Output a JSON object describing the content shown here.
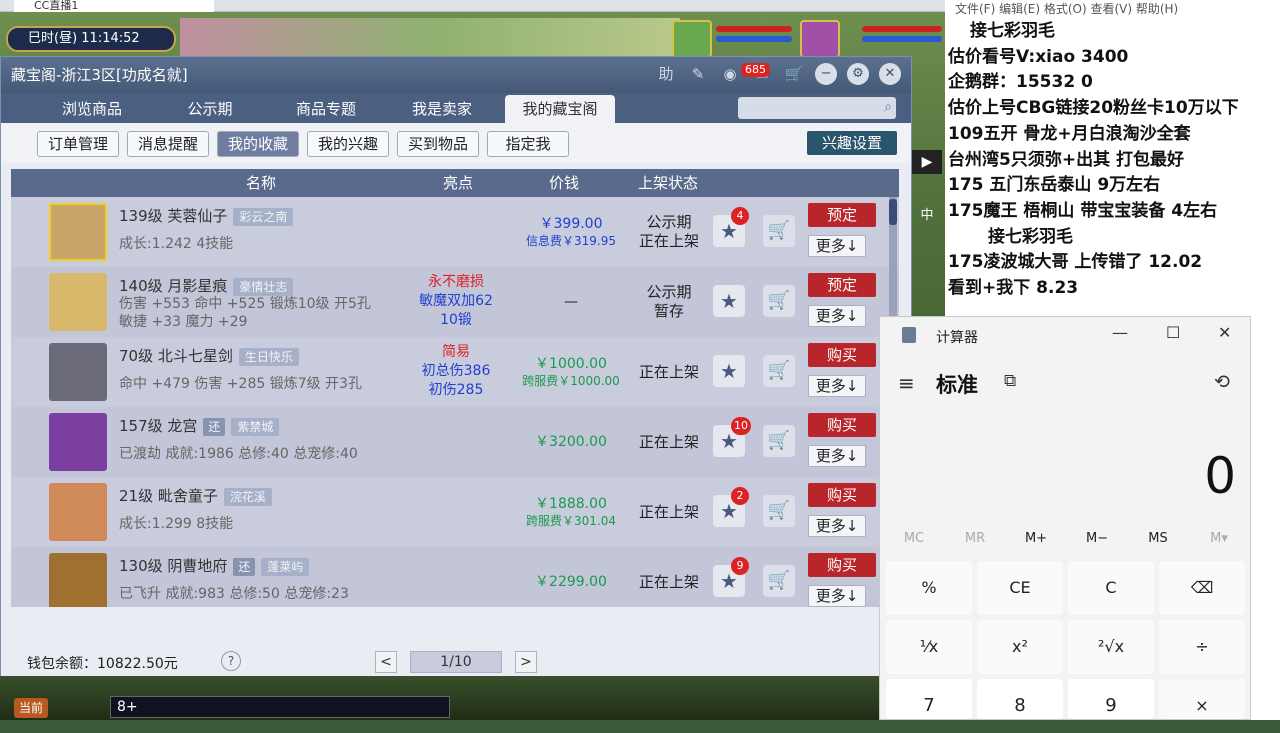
{
  "browser": {
    "tab_title": "CC直播1"
  },
  "game": {
    "time_text": "巳时(昼)  11:14:52"
  },
  "window": {
    "title": "藏宝阁-浙江3区[功成名就]",
    "notif_count": "685",
    "nav_tabs": [
      "浏览商品",
      "公示期",
      "商品专题",
      "我是卖家",
      "我的藏宝阁"
    ],
    "sub_tabs": [
      "订单管理",
      "消息提醒",
      "我的收藏",
      "我的兴趣",
      "买到物品",
      "指定我"
    ],
    "interest_settings": "兴趣设置",
    "columns": {
      "name": "名称",
      "highlight": "亮点",
      "price": "价钱",
      "status": "上架状态"
    },
    "items": [
      {
        "name": "139级  芙蓉仙子",
        "tag": "彩云之南",
        "tag2": "",
        "attrs": "成长:1.242  4技能",
        "hl": [
          "",
          "",
          ""
        ],
        "price": "￥399.00",
        "price_sub": "信息费￥319.95",
        "status": [
          "公示期",
          "正在上架"
        ],
        "badge": "4",
        "action": "预定",
        "more": "更多↓"
      },
      {
        "name": "140级  月影星痕",
        "tag": "豪情壮志",
        "tag2": "",
        "attrs": "伤害 +553  命中 +525  锻炼10级  开5孔",
        "attrs2": "敏捷 +33  魔力 +29",
        "hl": [
          "永不磨损",
          "敏魔双加62",
          "10锻"
        ],
        "price": "—",
        "price_sub": "",
        "status": [
          "公示期",
          "暂存"
        ],
        "badge": "",
        "action": "预定",
        "more": "更多↓"
      },
      {
        "name": "70级  北斗七星剑",
        "tag": "生日快乐",
        "tag2": "",
        "attrs": "命中 +479  伤害 +285  锻炼7级  开3孔",
        "hl": [
          "简易",
          "初总伤386",
          "初伤285"
        ],
        "price": "￥1000.00",
        "price_sub": "跨服费￥1000.00",
        "status": [
          "正在上架",
          ""
        ],
        "badge": "",
        "action": "购买",
        "more": "更多↓"
      },
      {
        "name": "157级  龙宫",
        "tag": "紫禁城",
        "tag2": "还",
        "attrs": "已渡劫  成就:1986  总修:40  总宠修:40",
        "hl": [
          "",
          "",
          ""
        ],
        "price": "￥3200.00",
        "price_sub": "",
        "status": [
          "正在上架",
          ""
        ],
        "badge": "10",
        "action": "购买",
        "more": "更多↓"
      },
      {
        "name": "21级  毗舍童子",
        "tag": "浣花溪",
        "tag2": "",
        "attrs": "成长:1.299  8技能",
        "hl": [
          "",
          "",
          ""
        ],
        "price": "￥1888.00",
        "price_sub": "跨服费￥301.04",
        "status": [
          "正在上架",
          ""
        ],
        "badge": "2",
        "action": "购买",
        "more": "更多↓"
      },
      {
        "name": "130级  阴曹地府",
        "tag": "蓬莱屿",
        "tag2": "还",
        "attrs": "已飞升  成就:983  总修:50  总宠修:23",
        "hl": [
          "",
          "",
          ""
        ],
        "price": "￥2299.00",
        "price_sub": "",
        "status": [
          "正在上架",
          ""
        ],
        "badge": "9",
        "action": "购买",
        "more": "更多↓"
      }
    ],
    "wallet": "钱包余额：10822.50元",
    "help": "?",
    "page": "1/10",
    "prev": "<",
    "next": ">"
  },
  "chat": {
    "current": "当前",
    "input": "8+"
  },
  "right_panel": {
    "menu": "文件(F)   编辑(E)   格式(O)   查看(V)   帮助(H)",
    "lines": [
      "接七彩羽毛",
      "估价看号V:xiao    3400",
      "企鹅群：15532    0",
      "估价上号CBG链接20粉丝卡10万以下",
      "109五开 骨龙+月白浪淘沙全套",
      "台州湾5只须弥+出其 打包最好",
      "175 五门东岳泰山  9万左右",
      "175魔王 梧桐山  带宝宝装备 4左右",
      "接七彩羽毛",
      "175凌波城大哥 上传错了 12.02",
      "看到+我下  8.23"
    ],
    "side_arrow": "▶",
    "side_text": "中"
  },
  "calculator": {
    "title": "计算器",
    "mode": "标准",
    "display": "0",
    "memory": [
      "MC",
      "MR",
      "M+",
      "M−",
      "MS",
      "M▾"
    ],
    "keys_row1": [
      "%",
      "CE",
      "C",
      "⌫"
    ],
    "keys_row2": [
      "¹⁄x",
      "x²",
      "²√x",
      "÷"
    ],
    "keys_row3": [
      "7",
      "8",
      "9",
      "×"
    ]
  }
}
